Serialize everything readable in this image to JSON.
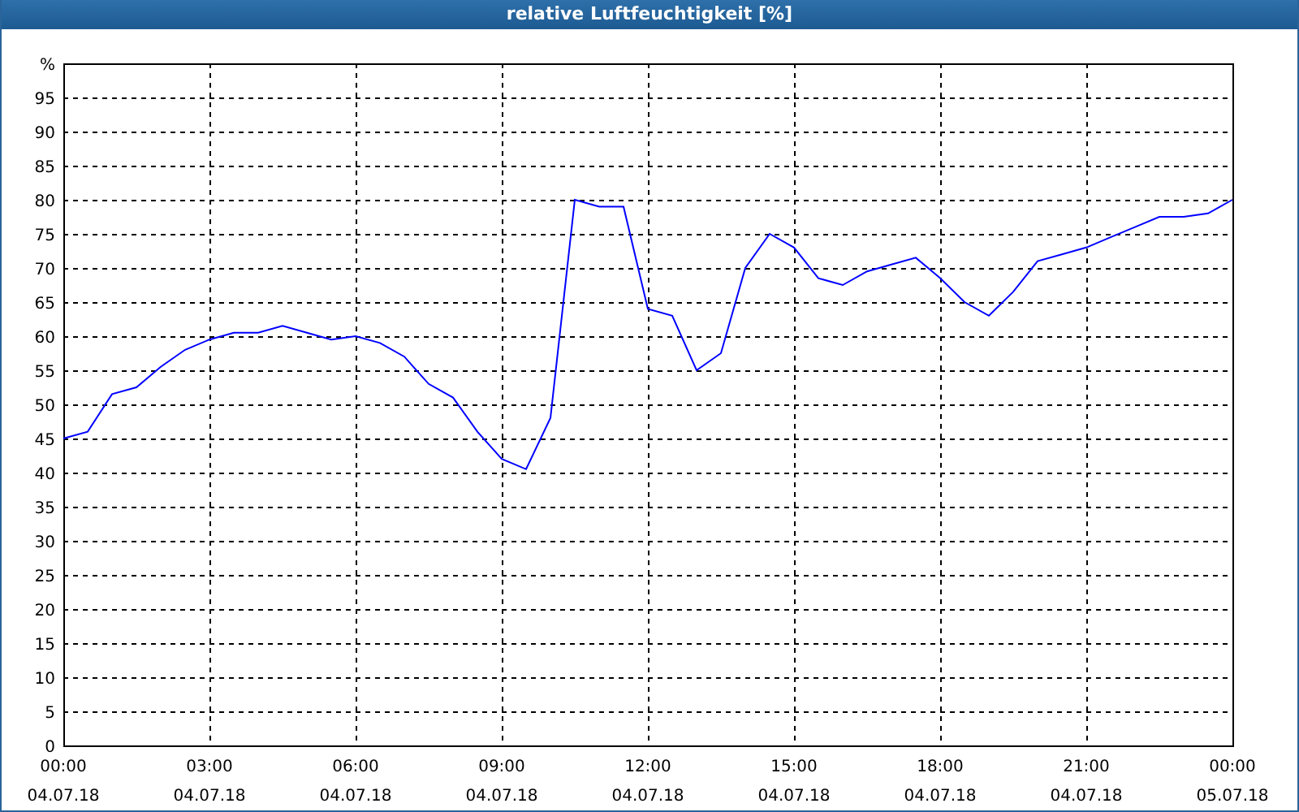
{
  "window": {
    "title": "relative Luftfeuchtigkeit [%]"
  },
  "chart": {
    "chart_data": {
      "type": "line",
      "grid": true,
      "ylim": [
        0,
        100
      ],
      "xlim": [
        0,
        24
      ],
      "yticks": [
        0,
        5,
        10,
        15,
        20,
        25,
        30,
        35,
        40,
        45,
        50,
        55,
        60,
        65,
        70,
        75,
        80,
        85,
        90,
        95,
        {
          "value": 100,
          "label": "%"
        }
      ],
      "xticks": [
        {
          "value": 0,
          "label": "00:00"
        },
        {
          "value": 3,
          "label": "03:00"
        },
        {
          "value": 6,
          "label": "06:00"
        },
        {
          "value": 9,
          "label": "09:00"
        },
        {
          "value": 12,
          "label": "12:00"
        },
        {
          "value": 15,
          "label": "15:00"
        },
        {
          "value": 18,
          "label": "18:00"
        },
        {
          "value": 21,
          "label": "21:00"
        },
        {
          "value": 24,
          "label": "00:00"
        }
      ],
      "x": [
        0,
        0.5,
        1,
        1.5,
        2,
        2.5,
        3,
        3.5,
        4,
        4.5,
        5,
        5.5,
        6,
        6.5,
        7,
        7.5,
        8,
        8.5,
        9,
        9.5,
        10,
        10.5,
        11,
        11.5,
        12,
        12.5,
        13,
        13.5,
        14,
        14.5,
        15,
        15.5,
        16,
        16.5,
        17,
        17.5,
        18,
        18.5,
        19,
        19.5,
        20,
        20.5,
        21,
        21.5,
        22,
        22.5,
        23,
        23.5,
        24
      ],
      "series": [
        {
          "color": "#0000ff",
          "values": [
            45,
            46,
            51.5,
            52.5,
            55.5,
            58,
            59.5,
            60.5,
            60.5,
            61.5,
            60.5,
            59.5,
            60,
            59,
            57,
            53,
            51,
            46,
            42,
            40.5,
            48,
            80,
            79,
            79,
            64,
            63,
            55,
            57.5,
            70,
            75,
            73,
            68.5,
            67.5,
            69.5,
            70.5,
            71.5,
            68.5,
            65,
            63,
            66.5,
            71,
            72,
            73,
            74.5,
            76,
            77.5,
            77.5,
            78,
            80
          ]
        }
      ]
    },
    "date_labels": [
      "04.07.18",
      "04.07.18",
      "04.07.18",
      "04.07.18",
      "04.07.18",
      "04.07.18",
      "04.07.18",
      "04.07.18",
      "05.07.18"
    ]
  }
}
